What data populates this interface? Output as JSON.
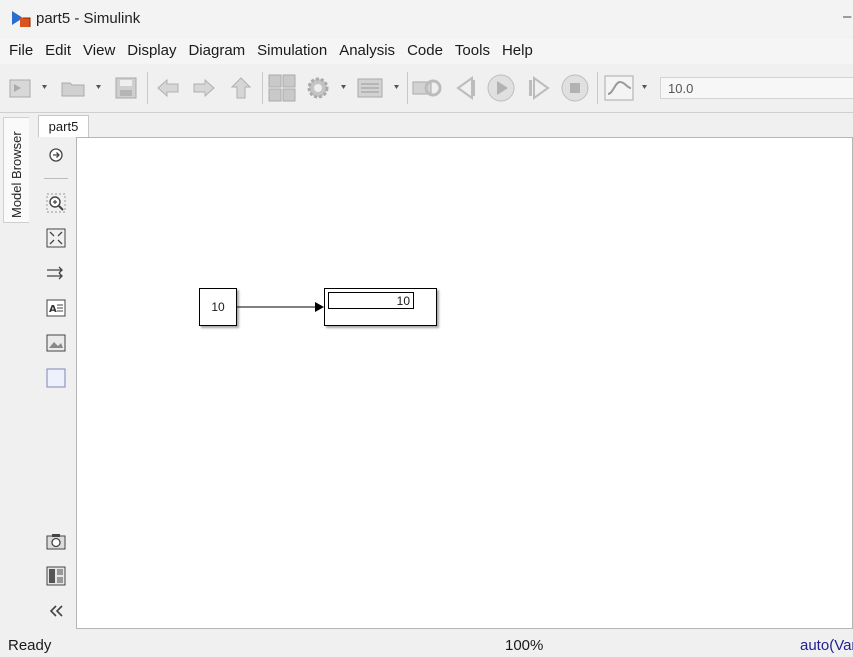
{
  "window": {
    "title": "part5 - Simulink",
    "minimize_glyph": "–"
  },
  "menu": [
    "File",
    "Edit",
    "View",
    "Display",
    "Diagram",
    "Simulation",
    "Analysis",
    "Code",
    "Tools",
    "Help"
  ],
  "toolbar": {
    "stop_time": "10.0",
    "icons": [
      "new-model-icon",
      "open-icon",
      "save-icon",
      "back-icon",
      "forward-icon",
      "up-icon",
      "library-browser-icon",
      "model-config-icon",
      "model-explorer-icon",
      "update-diagram-icon",
      "step-back-icon",
      "run-icon",
      "step-forward-icon",
      "stop-icon",
      "data-inspector-icon"
    ]
  },
  "model_browser": {
    "label": "Model Browser"
  },
  "doc_tab": {
    "label": "part5"
  },
  "canvas": {
    "blocks": [
      {
        "type": "Constant",
        "value": "10"
      },
      {
        "type": "Display",
        "value": "10"
      }
    ]
  },
  "status": {
    "left": "Ready",
    "zoom": "100%",
    "solver": "auto(Var"
  },
  "colors": {
    "accent": "#1f5fbf",
    "status_solver": "#1f1f8f",
    "canvas_bg": "#ffffff"
  }
}
